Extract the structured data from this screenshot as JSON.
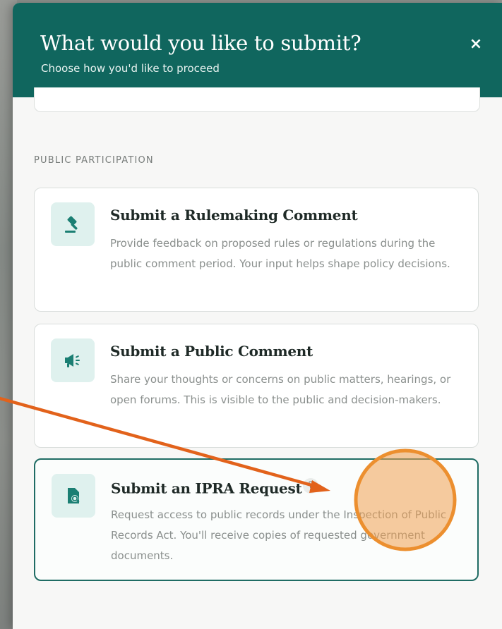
{
  "modal": {
    "title": "What would you like to submit?",
    "subtitle": "Choose how you'd like to proceed",
    "close_label": "×"
  },
  "section": {
    "label": "PUBLIC PARTICIPATION"
  },
  "options": [
    {
      "title": "Submit a Rulemaking Comment",
      "description": "Provide feedback on proposed rules or regulations during the public comment period. Your input helps shape policy decisions.",
      "icon": "gavel-icon"
    },
    {
      "title": "Submit a Public Comment",
      "description": "Share your thoughts or concerns on public matters, hearings, or open forums. This is visible to the public and decision-makers.",
      "icon": "megaphone-icon"
    },
    {
      "title": "Submit an IPRA Request",
      "description": "Request access to public records under the Inspection of Public Records Act. You'll receive copies of requested government documents.",
      "icon": "document-search-icon",
      "help_label": "?"
    }
  ],
  "colors": {
    "header": "#10665e",
    "icon_bg": "#dff1ee",
    "icon": "#1b7f73",
    "annotation_arrow": "#e2621b",
    "click_marker": "#f0a050"
  }
}
